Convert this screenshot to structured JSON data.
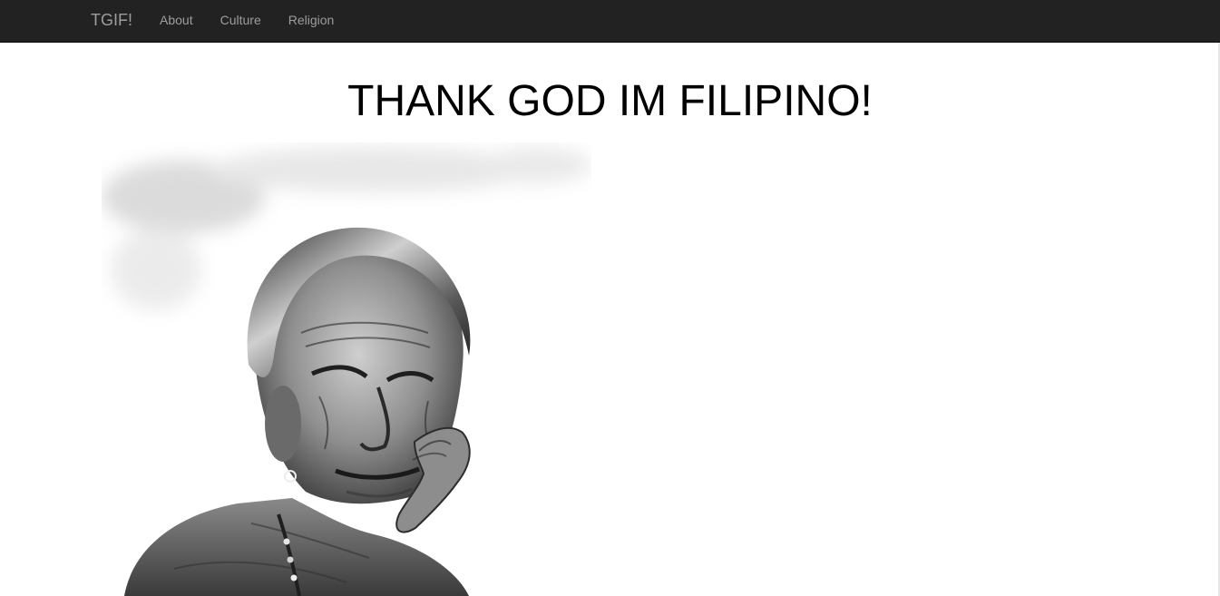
{
  "navbar": {
    "brand": "TGIF!",
    "links": [
      "About",
      "Culture",
      "Religion"
    ]
  },
  "main": {
    "title": "THANK GOD IM FILIPINO!",
    "image": {
      "subject": "black-and-white portrait of an elderly woman with hand on cheek"
    }
  },
  "colors": {
    "navbar_bg": "#222222",
    "nav_text": "#9d9d9d",
    "page_bg": "#ffffff",
    "title_text": "#000000"
  }
}
